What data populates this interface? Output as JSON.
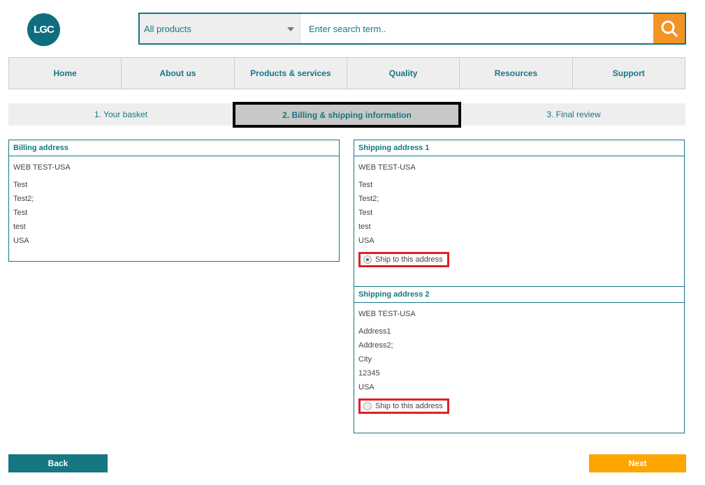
{
  "logo": "LGC",
  "search": {
    "category": "All products",
    "placeholder": "Enter search term.."
  },
  "nav": [
    "Home",
    "About us",
    "Products & services",
    "Quality",
    "Resources",
    "Support"
  ],
  "steps": [
    "1. Your basket",
    "2. Billing & shipping information",
    "3. Final review"
  ],
  "billing": {
    "title": "Billing address",
    "lines": [
      "WEB TEST-USA",
      "Test",
      "Test2;",
      "Test",
      "test",
      "USA"
    ]
  },
  "shipping": [
    {
      "title": "Shipping address 1",
      "lines": [
        "WEB TEST-USA",
        "Test",
        "Test2;",
        "Test",
        "test",
        "USA"
      ],
      "option": "Ship to this address",
      "selected": true
    },
    {
      "title": "Shipping address 2",
      "lines": [
        "WEB TEST-USA",
        "Address1",
        "Address2;",
        "City",
        "12345",
        "USA"
      ],
      "option": "Ship to this address",
      "selected": false
    }
  ],
  "buttons": {
    "back": "Back",
    "next": "Next"
  },
  "colors": {
    "teal": "#167682",
    "orange": "#f39425",
    "next": "#ffa500",
    "highlight": "#e01f26"
  }
}
